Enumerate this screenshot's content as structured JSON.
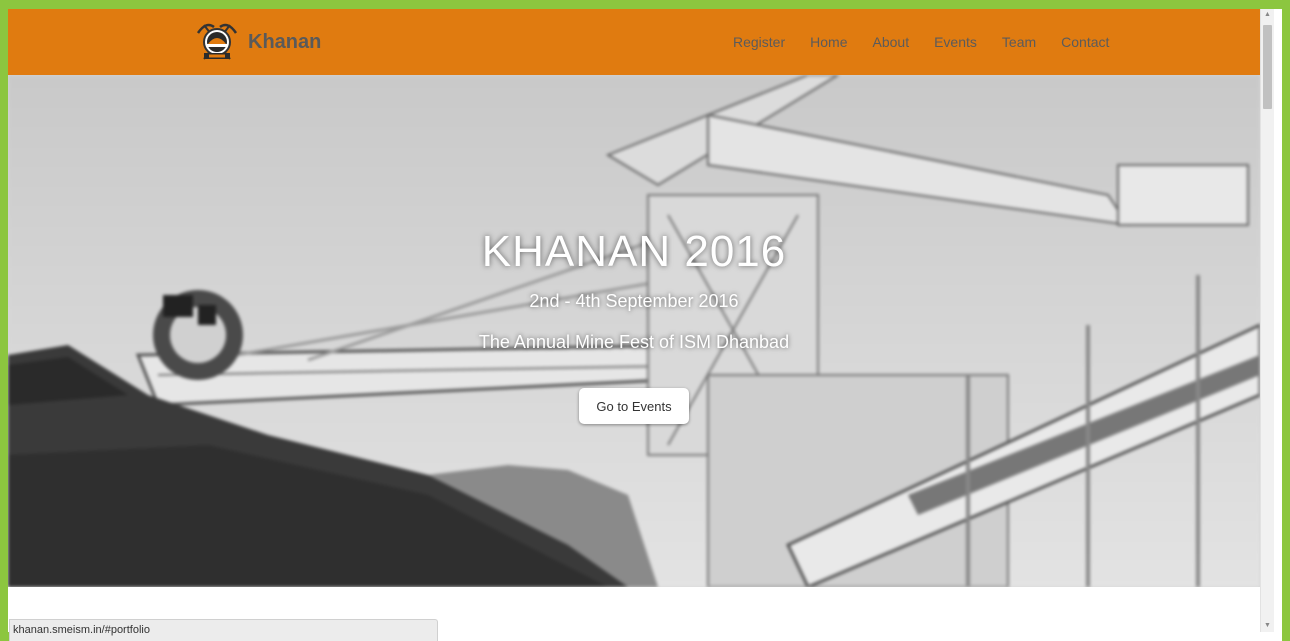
{
  "navbar": {
    "brand_name": "Khanan",
    "logo_icon": "pickaxe-helmet-logo",
    "links": [
      "Register",
      "Home",
      "About",
      "Events",
      "Team",
      "Contact"
    ],
    "background_color": "#e07b10"
  },
  "hero": {
    "title": "KHANAN 2016",
    "date": "2nd - 4th September 2016",
    "tagline": "The Annual Mine Fest of ISM Dhanbad",
    "button_label": "Go to Events",
    "background_image": "grayscale-mining-stacker-reclaimer"
  },
  "status_bar": {
    "url": "khanan.smeism.in/#portfolio"
  },
  "scrollbar": {
    "up_icon": "scroll-up-arrow-icon",
    "down_icon": "scroll-down-arrow-icon"
  },
  "page": {
    "border_color": "#8cc63f"
  }
}
